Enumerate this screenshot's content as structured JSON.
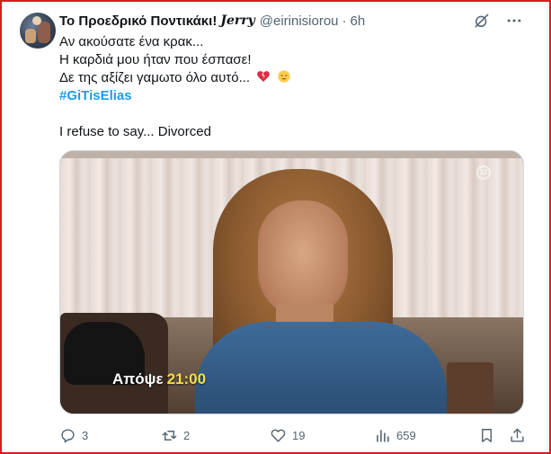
{
  "tweet": {
    "display_name": "Το Προεδρικό Ποντικάκι!",
    "display_name_decoration": "𝑱𝒆𝒓𝒓𝒚",
    "handle": "@eirinisiorou",
    "separator": "·",
    "time": "6h",
    "lines": [
      "Αν ακούσατε ένα κρακ...",
      "Η καρδιά μου ήταν που έσπασε!",
      "Δε της αξίζει γαμωτο όλο αυτό..."
    ],
    "hashtag": "#GiTisElias",
    "second_paragraph": "I refuse to say... Divorced",
    "icons": {
      "grok": "grok-icon",
      "more": "more-icon",
      "emoji_broken_heart": "broken-heart-emoji",
      "emoji_relieved": "sad-face-emoji"
    }
  },
  "media": {
    "channel_badge": "12",
    "promo_text": "Απόψε",
    "promo_time": "21:00"
  },
  "actions": {
    "replies": "3",
    "retweets": "2",
    "likes": "19",
    "views": "659"
  },
  "colors": {
    "accent": "#1d9bf0",
    "muted": "#536471",
    "frame": "#d21f1f",
    "promo_time": "#f5e04a"
  }
}
